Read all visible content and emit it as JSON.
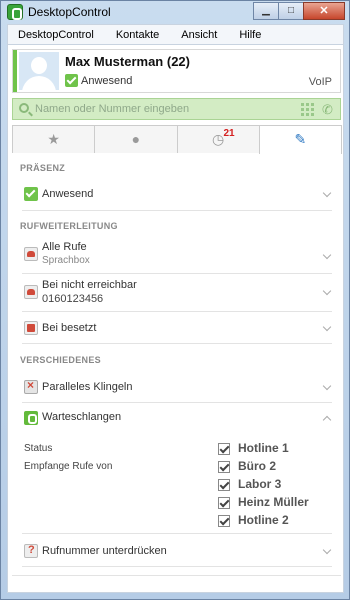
{
  "window": {
    "title": "DesktopControl"
  },
  "menu": [
    "DesktopControl",
    "Kontakte",
    "Ansicht",
    "Hilfe"
  ],
  "profile": {
    "name": "Max Musterman (22)",
    "status": "Anwesend",
    "line_type": "VoIP",
    "status_color": "#6fc34a"
  },
  "search": {
    "placeholder": "Namen oder Nummer eingeben"
  },
  "tabs": [
    {
      "name": "favorites",
      "icon": "star-icon"
    },
    {
      "name": "contacts",
      "icon": "person-icon"
    },
    {
      "name": "history",
      "icon": "clock-icon",
      "badge": "21"
    },
    {
      "name": "settings",
      "icon": "wrench-icon",
      "active": true
    }
  ],
  "sections": {
    "presence": {
      "title": "PRÄSENZ",
      "items": [
        {
          "label": "Anwesend",
          "icon": "check-icon"
        }
      ]
    },
    "forwarding": {
      "title": "RUFWEITERLEITUNG",
      "items": [
        {
          "label": "Alle Rufe",
          "sub": "Sprachbox",
          "icon": "forward-phone-icon"
        },
        {
          "label": "Bei nicht erreichbar",
          "sub": "0160123456",
          "icon": "unreachable-phone-icon"
        },
        {
          "label": "Bei besetzt",
          "icon": "busy-icon"
        }
      ]
    },
    "misc": {
      "title": "VERSCHIEDENES",
      "items": [
        {
          "label": "Paralleles Klingeln",
          "icon": "parallel-ring-icon"
        },
        {
          "label": "Warteschlangen",
          "icon": "queue-icon",
          "expanded": true
        },
        {
          "label": "Rufnummer unterdrücken",
          "icon": "hide-number-icon"
        }
      ]
    }
  },
  "queues": {
    "status_label": "Status",
    "receive_label": "Empfange Rufe von",
    "items": [
      {
        "name": "Hotline 1",
        "checked": true
      },
      {
        "name": "Büro 2",
        "checked": true
      },
      {
        "name": "Labor 3",
        "checked": true
      },
      {
        "name": "Heinz Müller",
        "checked": true
      },
      {
        "name": "Hotline 2",
        "checked": true
      }
    ]
  },
  "colors": {
    "accent_green": "#6fc34a",
    "badge_red": "#d42020",
    "settings_blue": "#2b77c2"
  }
}
